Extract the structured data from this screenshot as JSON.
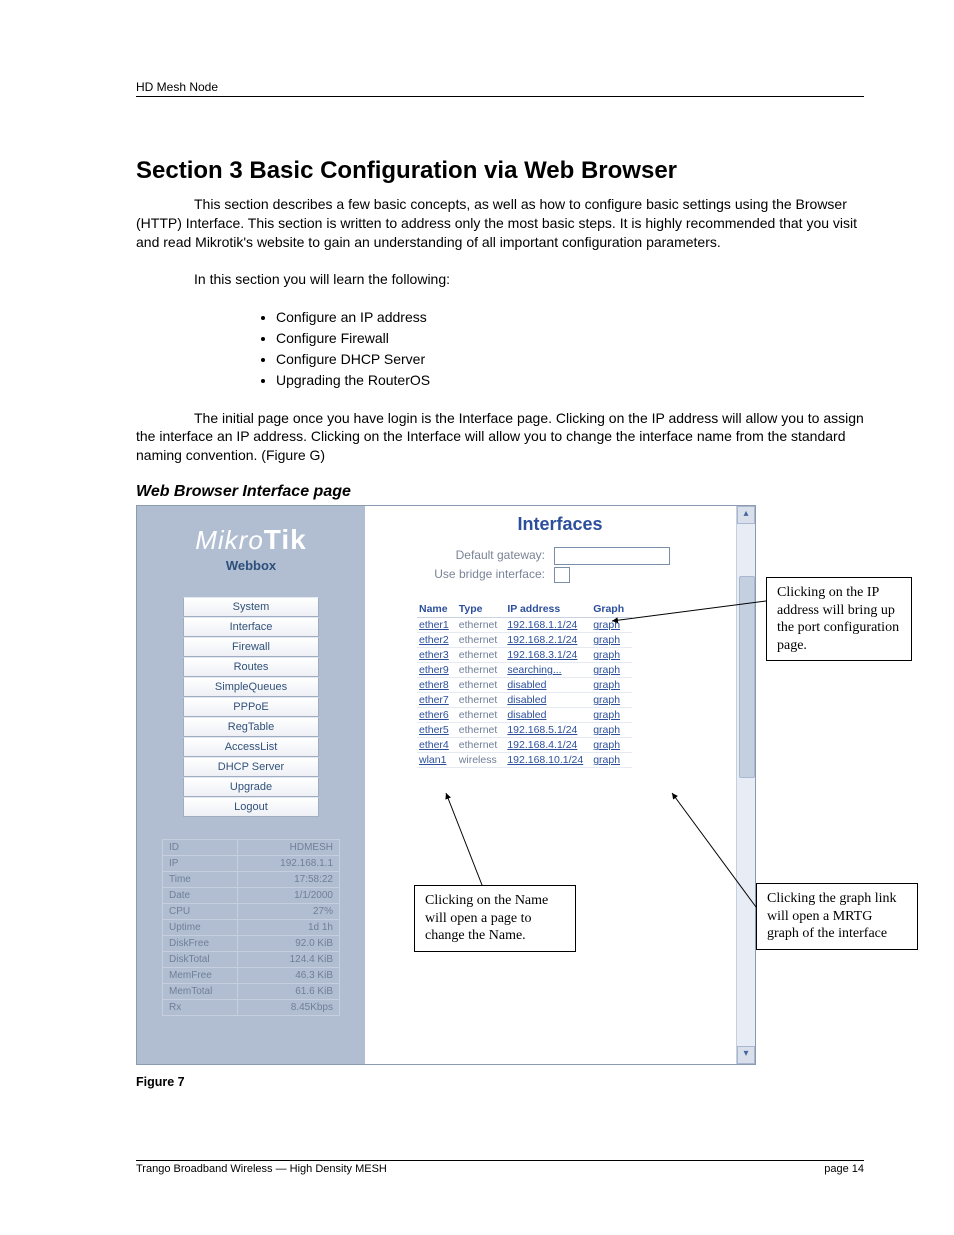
{
  "header": "HD Mesh Node",
  "title": "Section 3 Basic Configuration via Web Browser",
  "para1": "This section describes a few basic concepts, as well as how to configure basic settings using the Browser (HTTP) Interface.  This section is written to address only the most basic steps.  It is highly recommended that you visit and read Mikrotik's website to gain an understanding of all important configuration parameters.",
  "para2": "In this section you will learn the following:",
  "bullets": [
    "Configure an IP address",
    "Configure Firewall",
    "Configure DHCP Server",
    "Upgrading the RouterOS"
  ],
  "para3": "The initial page once you have login is the Interface page. Clicking on the IP address will allow you to assign the interface an IP address. Clicking on the Interface will allow you to change the interface name from the standard naming convention. (Figure G)",
  "subhead": "Web Browser Interface page",
  "logo_main": "Mikro",
  "logo_bold": "Tik",
  "logo_sub": "Webbox",
  "menu": [
    "System",
    "Interface",
    "Firewall",
    "Routes",
    "SimpleQueues",
    "PPPoE",
    "RegTable",
    "AccessList",
    "DHCP Server",
    "Upgrade",
    "Logout"
  ],
  "stats": [
    {
      "k": "ID",
      "v": "HDMESH"
    },
    {
      "k": "IP",
      "v": "192.168.1.1"
    },
    {
      "k": "Time",
      "v": "17:58:22"
    },
    {
      "k": "Date",
      "v": "1/1/2000"
    },
    {
      "k": "CPU",
      "v": "27%"
    },
    {
      "k": "Uptime",
      "v": "1d 1h"
    },
    {
      "k": "DiskFree",
      "v": "92.0 KiB"
    },
    {
      "k": "DiskTotal",
      "v": "124.4 KiB"
    },
    {
      "k": "MemFree",
      "v": "46.3 KiB"
    },
    {
      "k": "MemTotal",
      "v": "61.6 KiB"
    },
    {
      "k": "Rx",
      "v": "8.45Kbps"
    }
  ],
  "content_title": "Interfaces",
  "gateway_label": "Default gateway:",
  "bridge_label": "Use bridge interface:",
  "th": {
    "name": "Name",
    "type": "Type",
    "ip": "IP address",
    "graph": "Graph"
  },
  "rows": [
    {
      "name": "ether1",
      "type": "ethernet",
      "ip": "192.168.1.1/24",
      "graph": "graph"
    },
    {
      "name": "ether2",
      "type": "ethernet",
      "ip": "192.168.2.1/24",
      "graph": "graph"
    },
    {
      "name": "ether3",
      "type": "ethernet",
      "ip": "192.168.3.1/24",
      "graph": "graph"
    },
    {
      "name": "ether9",
      "type": "ethernet",
      "ip": "searching...",
      "graph": "graph"
    },
    {
      "name": "ether8",
      "type": "ethernet",
      "ip": "disabled",
      "graph": "graph"
    },
    {
      "name": "ether7",
      "type": "ethernet",
      "ip": "disabled",
      "graph": "graph"
    },
    {
      "name": "ether6",
      "type": "ethernet",
      "ip": "disabled",
      "graph": "graph"
    },
    {
      "name": "ether5",
      "type": "ethernet",
      "ip": "192.168.5.1/24",
      "graph": "graph"
    },
    {
      "name": "ether4",
      "type": "ethernet",
      "ip": "192.168.4.1/24",
      "graph": "graph"
    },
    {
      "name": "wlan1",
      "type": "wireless",
      "ip": "192.168.10.1/24",
      "graph": "graph"
    }
  ],
  "callout_ip": "Clicking on the IP address will bring up the port configuration page.",
  "callout_name": "Clicking on the Name will open a page to change the Name.",
  "callout_graph": "Clicking the graph link will open a MRTG graph of the interface",
  "figure_label": "Figure 7",
  "footer_left": "Trango Broadband Wireless — High Density MESH",
  "footer_right": "page 14"
}
